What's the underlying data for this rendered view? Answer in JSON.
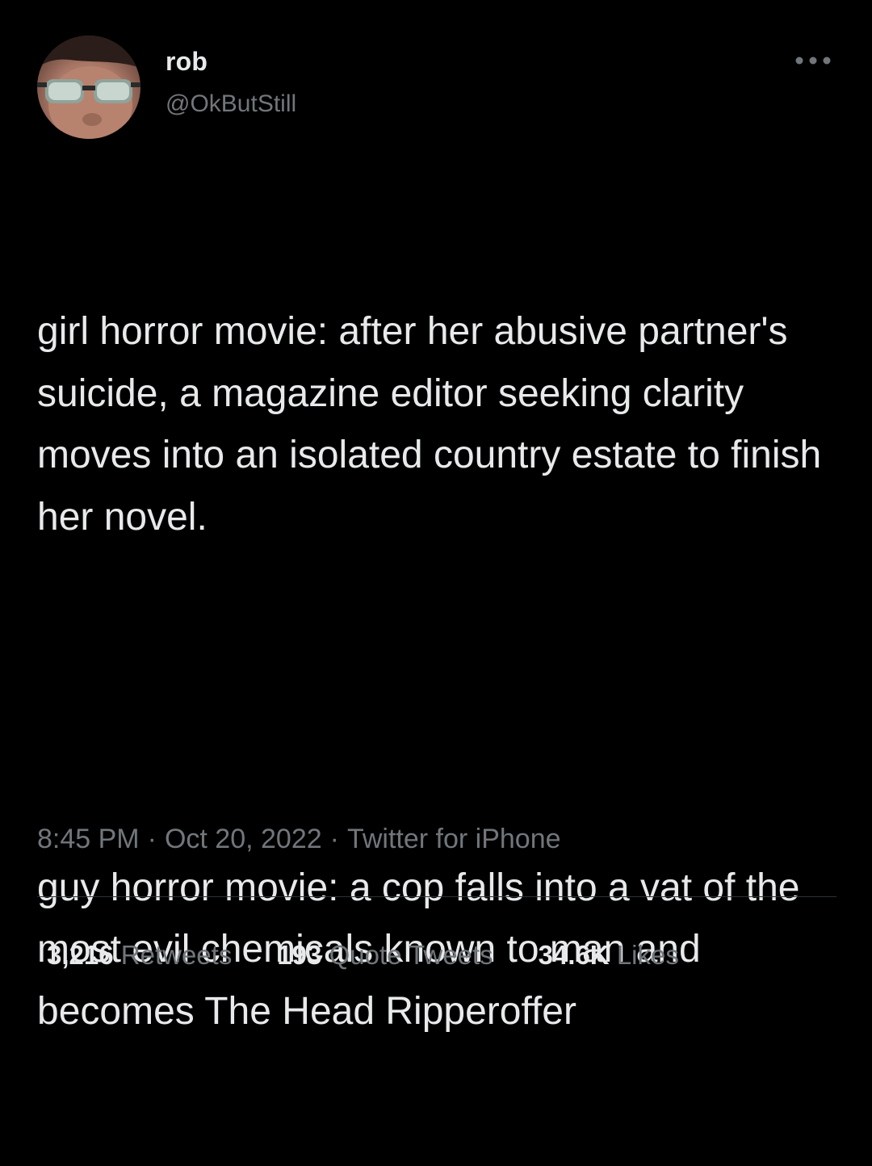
{
  "user": {
    "name": "rob",
    "handle": "@OkButStill"
  },
  "tweet": {
    "paragraph_1": "girl horror movie: after her abusive partner's suicide, a magazine editor seeking clarity moves into an isolated country estate to finish her novel.",
    "paragraph_2": "guy horror movie: a cop falls into a vat of the most evil chemicals known to man and becomes The Head Ripperoffer"
  },
  "meta": {
    "time": "8:45 PM",
    "date": "Oct 20, 2022",
    "separator": "·",
    "source": "Twitter for iPhone"
  },
  "stats": {
    "retweets_count": "3,216",
    "retweets_label": "Retweets",
    "quotes_count": "193",
    "quotes_label": "Quote Tweets",
    "likes_count": "34.6K",
    "likes_label": "Likes"
  },
  "icons": {
    "more": "more-horizontal-icon",
    "avatar": "avatar-sunglasses"
  },
  "colors": {
    "background": "#000000",
    "primary_text": "#e7e9ea",
    "secondary_text": "#71767b",
    "divider": "#2f3336"
  }
}
